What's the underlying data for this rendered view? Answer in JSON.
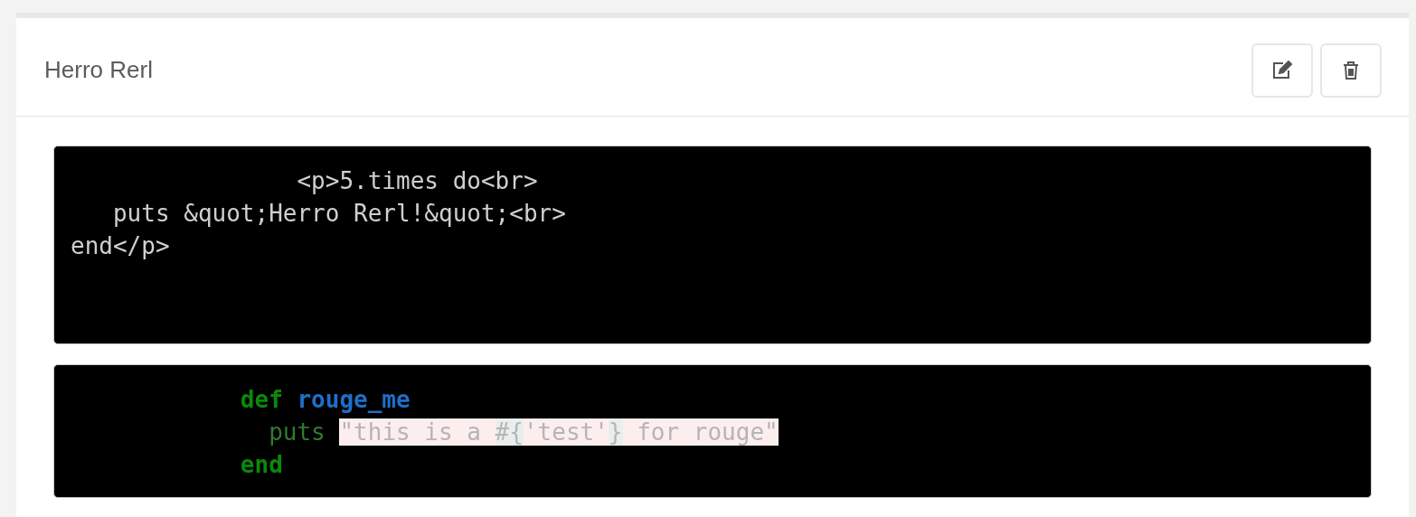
{
  "card": {
    "title": "Herro Rerl",
    "actions": [
      {
        "kind": "edit"
      },
      {
        "kind": "delete"
      }
    ]
  },
  "code_blocks": [
    {
      "kind": "plain",
      "lines": [
        "                <p>5.times do<br>",
        "   puts &quot;Herro Rerl!&quot;<br>",
        "end</p>"
      ]
    },
    {
      "kind": "highlighted",
      "lines": [
        [
          {
            "kind": "keyword",
            "text": "            def "
          },
          {
            "kind": "function",
            "text": "rouge_me"
          }
        ],
        [
          {
            "kind": "builtin",
            "text": "              puts "
          },
          {
            "kind": "string",
            "text": "\"this is a "
          },
          {
            "kind": "interpolation",
            "text": "#{"
          },
          {
            "kind": "string",
            "text": "'test'"
          },
          {
            "kind": "interpolation",
            "text": "}"
          },
          {
            "kind": "string",
            "text": " for rouge\""
          }
        ],
        [
          {
            "kind": "keyword",
            "text": "            end"
          }
        ]
      ]
    }
  ]
}
